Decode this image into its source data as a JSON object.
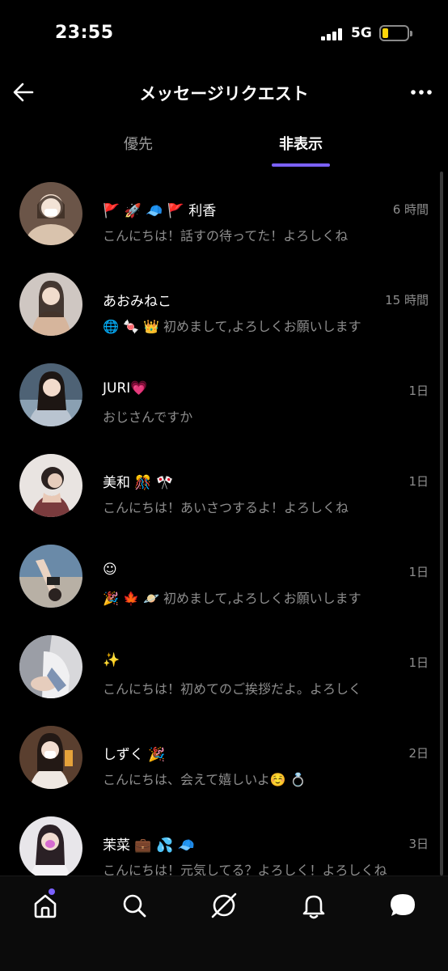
{
  "status_bar": {
    "time": "23:55",
    "network": "5G",
    "battery_color": "#ffd60a"
  },
  "header": {
    "title": "メッセージリクエスト",
    "back_icon": "arrow-left-icon",
    "more_icon": "more-horizontal-icon"
  },
  "tabs": [
    {
      "label": "優先",
      "active": false
    },
    {
      "label": "非表示",
      "active": true
    }
  ],
  "accent_color": "#7b61ff",
  "messages": [
    {
      "name": "🚩 🚀 🧢 🚩 利香",
      "time": "6 時間",
      "preview": "こんにちは！話すの待ってた！よろしくね"
    },
    {
      "name": "あおみねこ",
      "time": "15 時間",
      "preview": "🌐 🍬 👑 初めまして,よろしくお願いします"
    },
    {
      "name": "JURI💗",
      "time": "1日",
      "preview": "おじさんですか"
    },
    {
      "name": "美和 🎊 🎌",
      "time": "1日",
      "preview": "こんにちは！あいさつするよ！よろしくね"
    },
    {
      "name": "☺",
      "time": "1日",
      "preview": "🎉 🍁 🪐 初めまして,よろしくお願いします"
    },
    {
      "name": "✨",
      "time": "1日",
      "preview": "こんにちは！初めてのご挨拶だよ。よろしく"
    },
    {
      "name": "しずく 🎉",
      "time": "2日",
      "preview": "こんにちは、会えて嬉しいよ☺️ 💍"
    },
    {
      "name": "茉菜 💼 💦 🧢",
      "time": "3日",
      "preview": "こんにちは！元気してる？よろしく！よろしくね"
    }
  ],
  "bottom_nav": [
    {
      "icon": "home-icon",
      "active": true
    },
    {
      "icon": "search-icon",
      "active": false
    },
    {
      "icon": "compass-icon",
      "active": false
    },
    {
      "icon": "bell-icon",
      "active": false
    },
    {
      "icon": "chat-bubble-icon",
      "active": false
    }
  ]
}
